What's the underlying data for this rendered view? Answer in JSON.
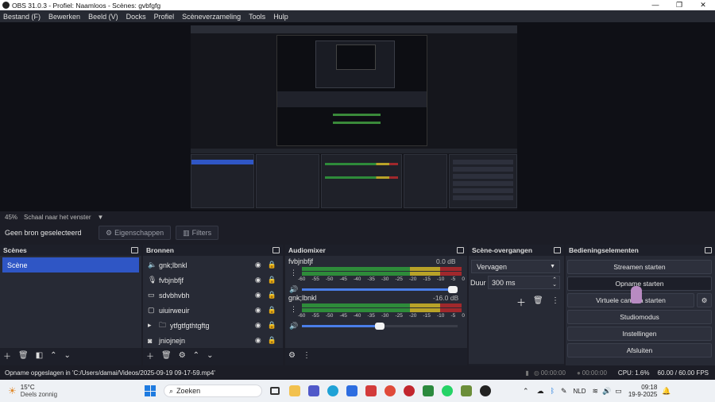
{
  "window": {
    "title": "OBS 31.0.3 - Profiel: Naamloos - Scènes: gvbfgfg",
    "controls": [
      "—",
      "❐",
      "✕"
    ]
  },
  "menu": [
    "Bestand (F)",
    "Bewerken",
    "Beeld (V)",
    "Docks",
    "Profiel",
    "Scèneverzameling",
    "Tools",
    "Hulp"
  ],
  "preview": {
    "zoom": "45%",
    "scale_label": "Schaal naar het venster"
  },
  "source_toolbar": {
    "no_source": "Geen bron geselecteerd",
    "properties": "Eigenschappen",
    "filters": "Filters"
  },
  "scenes": {
    "title": "Scènes",
    "items": [
      "Scène"
    ]
  },
  "sources": {
    "title": "Bronnen",
    "items": [
      {
        "name": "gnk;lbnkl",
        "icon": "speaker-icon"
      },
      {
        "name": "fvbjnbfjf",
        "icon": "microphone-icon"
      },
      {
        "name": "sdvbhvbh",
        "icon": "monitor-icon"
      },
      {
        "name": "uiuirweuir",
        "icon": "window-icon"
      },
      {
        "name": "ytfgtfgthtgftg",
        "icon": "folder-icon"
      },
      {
        "name": "jniojnejn",
        "icon": "camera-icon"
      }
    ]
  },
  "mixer": {
    "title": "Audiomixer",
    "channels": [
      {
        "name": "fvbjnbfjf",
        "db": "0.0 dB",
        "volume_fraction": 1.0
      },
      {
        "name": "gnk;lbnkl",
        "db": "-16.0 dB",
        "volume_fraction": 0.53
      }
    ],
    "scale": [
      "-60",
      "-55",
      "-50",
      "-45",
      "-40",
      "-35",
      "-30",
      "-25",
      "-20",
      "-15",
      "-10",
      "-5",
      "0"
    ]
  },
  "transitions": {
    "title": "Scène-overgangen",
    "selected": "Vervagen",
    "duration_label": "Duur",
    "duration_value": "300 ms"
  },
  "controls": {
    "title": "Bedieningselementen",
    "buttons": [
      "Streamen starten",
      "Opname starten",
      "Virtuele camera starten",
      "Studiomodus",
      "Instellingen",
      "Afsluiten"
    ]
  },
  "status": {
    "message": "Opname opgeslagen in 'C:/Users/damai/Videos/2025-09-19 09-17-59.mp4'",
    "stream_time": "00:00:00",
    "rec_time": "00:00:00",
    "cpu": "CPU: 1.6%",
    "fps": "60.00 / 60.00 FPS"
  },
  "taskbar": {
    "weather_temp": "15°C",
    "weather_desc": "Deels zonnig",
    "search": "Zoeken",
    "language": "NLD",
    "time": "09:18",
    "date": "19-9-2025"
  },
  "colors": {
    "accent": "#2f56c5",
    "meter_green": "#2e8b3a",
    "meter_yellow": "#b8a228",
    "meter_red": "#a0282c"
  }
}
